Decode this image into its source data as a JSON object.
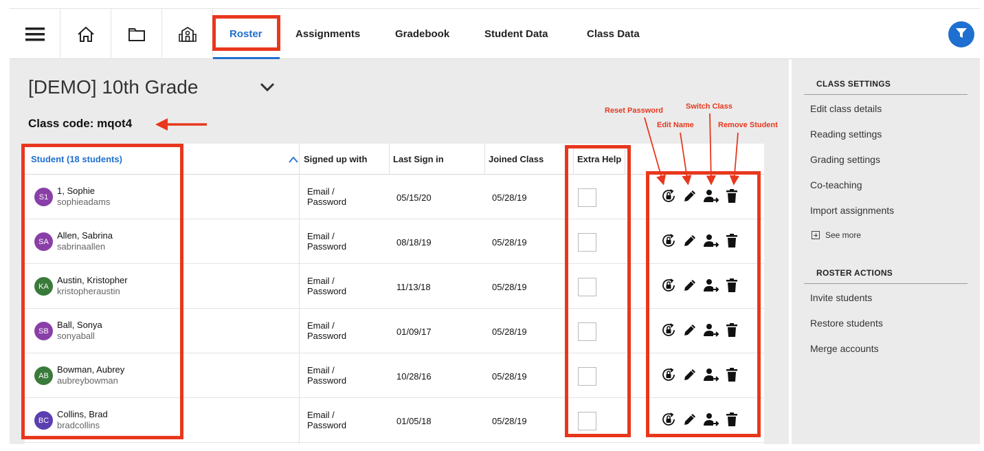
{
  "nav": {
    "icons": [
      "menu-icon",
      "home-icon",
      "folder-icon",
      "school-icon",
      "filter-icon"
    ],
    "tabs": [
      {
        "label": "Roster",
        "active": true
      },
      {
        "label": "Assignments",
        "active": false
      },
      {
        "label": "Gradebook",
        "active": false
      },
      {
        "label": "Student Data",
        "active": false
      },
      {
        "label": "Class Data",
        "active": false
      }
    ]
  },
  "class": {
    "title": "[DEMO] 10th Grade",
    "code_label": "Class code: mqot4"
  },
  "table": {
    "headers": {
      "student": "Student (18 students)",
      "signed_up_with": "Signed up with",
      "last_sign_in": "Last Sign in",
      "joined_class": "Joined Class",
      "extra_help": "Extra Help"
    },
    "rows": [
      {
        "initials": "S1",
        "name": "1, Sophie",
        "username": "sophieadams",
        "signup_line1": "Email /",
        "signup_line2": "Password",
        "last_sign_in": "05/15/20",
        "joined": "05/28/19",
        "extra_help": false,
        "avatar_color": "#8a3fa8"
      },
      {
        "initials": "SA",
        "name": "Allen, Sabrina",
        "username": "sabrinaallen",
        "signup_line1": "Email /",
        "signup_line2": "Password",
        "last_sign_in": "08/18/19",
        "joined": "05/28/19",
        "extra_help": false,
        "avatar_color": "#8a3fa8"
      },
      {
        "initials": "KA",
        "name": "Austin, Kristopher",
        "username": "kristopheraustin",
        "signup_line1": "Email /",
        "signup_line2": "Password",
        "last_sign_in": "11/13/18",
        "joined": "05/28/19",
        "extra_help": false,
        "avatar_color": "#3a7a3a"
      },
      {
        "initials": "SB",
        "name": "Ball, Sonya",
        "username": "sonyaball",
        "signup_line1": "Email /",
        "signup_line2": "Password",
        "last_sign_in": "01/09/17",
        "joined": "05/28/19",
        "extra_help": false,
        "avatar_color": "#8a3fa8"
      },
      {
        "initials": "AB",
        "name": "Bowman, Aubrey",
        "username": "aubreybowman",
        "signup_line1": "Email /",
        "signup_line2": "Password",
        "last_sign_in": "10/28/16",
        "joined": "05/28/19",
        "extra_help": false,
        "avatar_color": "#3a7a3a"
      },
      {
        "initials": "BC",
        "name": "Collins, Brad",
        "username": "bradcollins",
        "signup_line1": "Email /",
        "signup_line2": "Password",
        "last_sign_in": "01/05/18",
        "joined": "05/28/19",
        "extra_help": false,
        "avatar_color": "#5b3fb0"
      }
    ],
    "row_actions": [
      "reset-password-icon",
      "edit-name-icon",
      "switch-class-icon",
      "remove-student-icon"
    ]
  },
  "sidebar": {
    "class_settings_title": "CLASS SETTINGS",
    "class_settings": [
      "Edit class details",
      "Reading settings",
      "Grading settings",
      "Co-teaching",
      "Import assignments"
    ],
    "see_more": "See more",
    "roster_actions_title": "ROSTER ACTIONS",
    "roster_actions": [
      "Invite students",
      "Restore students",
      "Merge accounts"
    ]
  },
  "annotations": {
    "reset_password": "Reset Password",
    "edit_name": "Edit Name",
    "switch_class": "Switch Class",
    "remove_student": "Remove Student",
    "color": "#e8371d"
  },
  "colors": {
    "accent": "#1f6fd0",
    "annotation_red": "#e8371d",
    "panel_grey": "#ebebeb"
  }
}
